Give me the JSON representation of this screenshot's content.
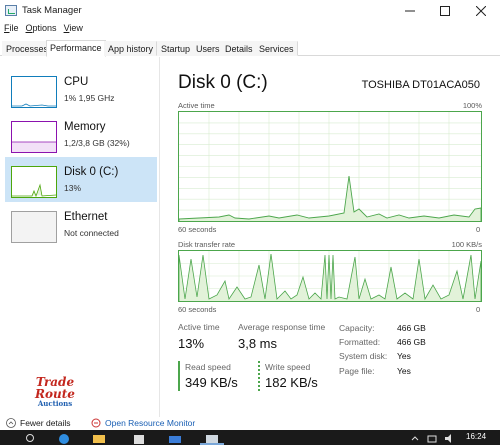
{
  "window": {
    "title": "Task Manager"
  },
  "menu": [
    "File",
    "Options",
    "View"
  ],
  "menu_underline": [
    "F",
    "O",
    "V"
  ],
  "tabs": [
    "Processes",
    "Performance",
    "App history",
    "Startup",
    "Users",
    "Details",
    "Services"
  ],
  "active_tab": "Performance",
  "sidebar": [
    {
      "name": "CPU",
      "sub": "1% 1,95 GHz",
      "color": "#117dbb"
    },
    {
      "name": "Memory",
      "sub": "1,2/3,8 GB (32%)",
      "color": "#8b12ae"
    },
    {
      "name": "Disk 0 (C:)",
      "sub": "13%",
      "color": "#4da60c"
    },
    {
      "name": "Ethernet",
      "sub": "Not connected",
      "color": "#a0a0a0"
    }
  ],
  "main": {
    "title": "Disk 0 (C:)",
    "model": "TOSHIBA DT01ACA050",
    "graph1": {
      "label": "Active time",
      "max": "100%",
      "left_bottom": "60 seconds",
      "right_bottom": "0"
    },
    "graph2": {
      "label": "Disk transfer rate",
      "max": "100 KB/s",
      "left_bottom": "60 seconds",
      "right_bottom": "0"
    }
  },
  "stats": {
    "active_time_label": "Active time",
    "active_time_value": "13%",
    "avg_resp_label": "Average response time",
    "avg_resp_value": "3,8 ms",
    "read_label": "Read speed",
    "read_value": "349 KB/s",
    "write_label": "Write speed",
    "write_value": "182 KB/s"
  },
  "properties": [
    {
      "label": "Capacity:",
      "value": "466 GB"
    },
    {
      "label": "Formatted:",
      "value": "466 GB"
    },
    {
      "label": "System disk:",
      "value": "Yes"
    },
    {
      "label": "Page file:",
      "value": "Yes"
    }
  ],
  "footer": {
    "fewer_details": "Fewer details",
    "open_monitor": "Open Resource Monitor"
  },
  "watermark": {
    "line1": "Trade",
    "line2": "Route",
    "line3": "Auctions"
  },
  "taskbar": {
    "time": "16:24"
  },
  "colors": {
    "accent": "#4ca64c",
    "selected": "#cce4f7",
    "link": "#1a5fb4"
  }
}
